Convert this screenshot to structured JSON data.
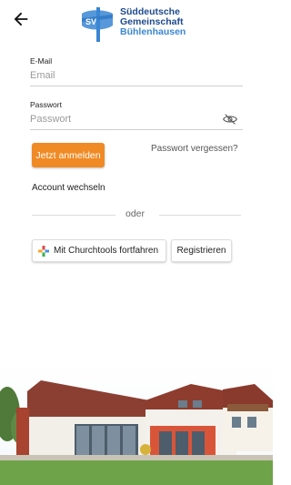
{
  "header": {
    "back_icon": "arrow-left-icon",
    "logo": {
      "mark_text": "SV",
      "line1": "Süddeutsche",
      "line2": "Gemeinschaft",
      "line3": "Bühlenhausen"
    }
  },
  "form": {
    "email": {
      "label": "E-Mail",
      "placeholder": "Email",
      "value": ""
    },
    "password": {
      "label": "Passwort",
      "placeholder": "Passwort",
      "value": "",
      "toggle_icon": "eye-off-icon"
    },
    "login_label": "Jetzt anmelden",
    "forgot_label": "Passwort vergessen?",
    "switch_account_label": "Account wechseln",
    "divider_label": "oder",
    "churchtools_label": "Mit Churchtools fortfahren",
    "churchtools_icon": "churchtools-cross-icon",
    "register_label": "Registrieren"
  },
  "colors": {
    "primary": "#f08a24",
    "brand_dark": "#1d4a8f",
    "brand_light": "#3a86d4"
  }
}
